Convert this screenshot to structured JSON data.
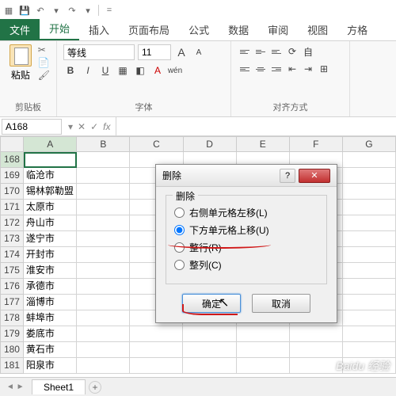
{
  "qat": {
    "save": "💾",
    "undo": "↶",
    "redo": "↷",
    "down": "▾",
    "eq": "="
  },
  "tabs": [
    "文件",
    "开始",
    "插入",
    "页面布局",
    "公式",
    "数据",
    "审阅",
    "视图",
    "方格"
  ],
  "active_tab_index": 1,
  "ribbon": {
    "clipboard": {
      "paste": "粘贴",
      "label": "剪贴板"
    },
    "font": {
      "name": "等线",
      "size": "11",
      "inc": "A",
      "dec": "A",
      "bold": "B",
      "italic": "I",
      "underline": "U",
      "label": "字体",
      "wen": "wén"
    },
    "align": {
      "label": "对齐方式",
      "wrap": "自"
    }
  },
  "namebox": "A168",
  "fx": "fx",
  "columns": [
    "A",
    "B",
    "C",
    "D",
    "E",
    "F",
    "G"
  ],
  "rows": [
    {
      "n": 168,
      "a": ""
    },
    {
      "n": 169,
      "a": "临沧市"
    },
    {
      "n": 170,
      "a": "锡林郭勒盟"
    },
    {
      "n": 171,
      "a": "太原市"
    },
    {
      "n": 172,
      "a": "舟山市"
    },
    {
      "n": 173,
      "a": "遂宁市"
    },
    {
      "n": 174,
      "a": "开封市"
    },
    {
      "n": 175,
      "a": "淮安市"
    },
    {
      "n": 176,
      "a": "承德市"
    },
    {
      "n": 177,
      "a": "淄博市"
    },
    {
      "n": 178,
      "a": "蚌埠市"
    },
    {
      "n": 179,
      "a": "娄底市"
    },
    {
      "n": 180,
      "a": "黄石市"
    },
    {
      "n": 181,
      "a": "阳泉市"
    }
  ],
  "sheet": {
    "name": "Sheet1",
    "add": "+"
  },
  "dialog": {
    "title": "删除",
    "group": "删除",
    "options": [
      {
        "label": "右侧单元格左移(L)",
        "checked": false
      },
      {
        "label": "下方单元格上移(U)",
        "checked": true
      },
      {
        "label": "整行(R)",
        "checked": false
      },
      {
        "label": "整列(C)",
        "checked": false
      }
    ],
    "ok": "确定",
    "cancel": "取消",
    "help": "?",
    "close": "✕"
  },
  "watermark": "Baidu 经验"
}
